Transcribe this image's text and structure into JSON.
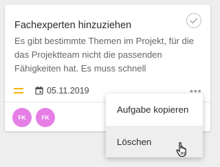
{
  "card": {
    "title": "Fachexperten hinzuziehen",
    "description": "Es gibt bestimmte Themen im Projekt, für die das Projektteam nicht die passenden Fähigkeiten hat. Es muss schnell",
    "priority_icon": "priority-medium-icon",
    "priority_color": "#f5b400",
    "date_icon": "calendar-icon",
    "due_date": "05.11.2019",
    "more_icon": "more-horizontal-icon",
    "assignees": [
      {
        "initials": "FK",
        "color": "#e57fe6"
      },
      {
        "initials": "FK",
        "color": "#e57fe6"
      }
    ]
  },
  "context_menu": {
    "items": [
      {
        "label": "Aufgabe kopieren"
      },
      {
        "label": "Löschen"
      }
    ]
  }
}
